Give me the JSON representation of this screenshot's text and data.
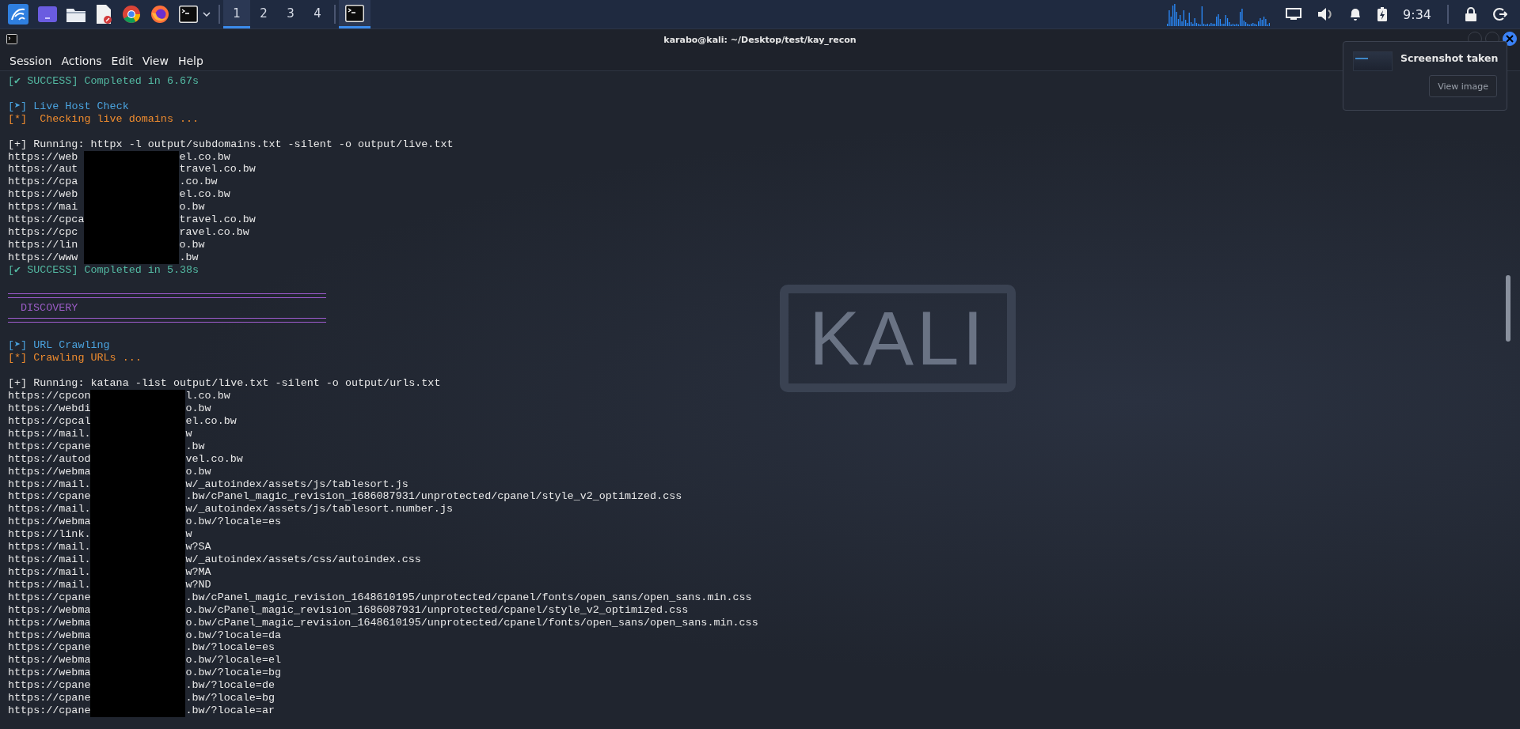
{
  "taskbar": {
    "launchers": [
      {
        "kind": "dragon"
      },
      {
        "kind": "desktop"
      },
      {
        "kind": "folder"
      },
      {
        "kind": "editor"
      },
      {
        "kind": "chrome"
      },
      {
        "kind": "fox"
      },
      {
        "kind": "terminal"
      }
    ],
    "workspaces": [
      {
        "label": "1",
        "selected": true
      },
      {
        "label": "2",
        "selected": false
      },
      {
        "label": "3",
        "selected": false
      },
      {
        "label": "4",
        "selected": false
      }
    ],
    "tasks": [
      {
        "kind": "terminal",
        "selected": true
      }
    ],
    "clock": "9:34"
  },
  "window": {
    "title": "karabo@kali: ~/Desktop/test/kay_recon",
    "menu": [
      "Session",
      "Actions",
      "Edit",
      "View",
      "Help"
    ],
    "lines": [
      {
        "kind": "success",
        "text": "[✔ SUCCESS] Completed in 6.67s"
      },
      {
        "kind": "blank"
      },
      {
        "kind": "step",
        "text": "[➤] Live Host Check"
      },
      {
        "kind": "info",
        "text": "[*]  Checking live domains ..."
      },
      {
        "kind": "blank"
      },
      {
        "kind": "plain",
        "text": "[+] Running: httpx -l output/subdomains.txt -silent -o output/live.txt"
      },
      {
        "kind": "redacted",
        "rows": [
          {
            "start": "https://web",
            "end": "el.co.bw"
          },
          {
            "start": "https://aut",
            "end": "travel.co.bw"
          },
          {
            "start": "https://cpa",
            "end": ".co.bw"
          },
          {
            "start": "https://web",
            "end": "el.co.bw"
          },
          {
            "start": "https://mai",
            "end": "o.bw"
          },
          {
            "start": "https://cpca",
            "end": "travel.co.bw"
          },
          {
            "start": "https://cpc",
            "end": "ravel.co.bw"
          },
          {
            "start": "https://lin",
            "end": "o.bw"
          },
          {
            "start": "https://www",
            "end": ".bw"
          }
        ]
      },
      {
        "kind": "success",
        "text": "[✔ SUCCESS] Completed in 5.38s"
      },
      {
        "kind": "blank"
      },
      {
        "kind": "rule"
      },
      {
        "kind": "banner",
        "text": "DISCOVERY"
      },
      {
        "kind": "rule"
      },
      {
        "kind": "blank"
      },
      {
        "kind": "step",
        "text": "[➤] URL Crawling"
      },
      {
        "kind": "info",
        "text": "[*] Crawling URLs ..."
      },
      {
        "kind": "blank"
      },
      {
        "kind": "plain",
        "text": "[+] Running: katana -list output/live.txt -silent -o output/urls.txt"
      },
      {
        "kind": "redacted",
        "rows": [
          {
            "start": "https://cpcon",
            "end": "l.co.bw"
          },
          {
            "start": "https://webdi",
            "end": "o.bw"
          },
          {
            "start": "https://cpcal",
            "end": "el.co.bw"
          },
          {
            "start": "https://mail.",
            "end": "w"
          },
          {
            "start": "https://cpane",
            "end": ".bw"
          },
          {
            "start": "https://autod",
            "end": "vel.co.bw"
          },
          {
            "start": "https://webma",
            "end": "o.bw"
          },
          {
            "start": "https://mail.",
            "end": "w/_autoindex/assets/js/tablesort.js"
          },
          {
            "start": "https://cpane",
            "end": ".bw/cPanel_magic_revision_1686087931/unprotected/cpanel/style_v2_optimized.css"
          },
          {
            "start": "https://mail.",
            "end": "w/_autoindex/assets/js/tablesort.number.js"
          },
          {
            "start": "https://webma",
            "end": "o.bw/?locale=es"
          },
          {
            "start": "https://link.",
            "end": "w"
          },
          {
            "start": "https://mail.",
            "end": "w?SA"
          },
          {
            "start": "https://mail.",
            "end": "w/_autoindex/assets/css/autoindex.css"
          },
          {
            "start": "https://mail.",
            "end": "w?MA"
          },
          {
            "start": "https://mail.",
            "end": "w?ND"
          },
          {
            "start": "https://cpane",
            "end": ".bw/cPanel_magic_revision_1648610195/unprotected/cpanel/fonts/open_sans/open_sans.min.css"
          },
          {
            "start": "https://webma",
            "end": "o.bw/cPanel_magic_revision_1686087931/unprotected/cpanel/style_v2_optimized.css"
          },
          {
            "start": "https://webma",
            "end": "o.bw/cPanel_magic_revision_1648610195/unprotected/cpanel/fonts/open_sans/open_sans.min.css"
          },
          {
            "start": "https://webma",
            "end": "o.bw/?locale=da"
          },
          {
            "start": "https://cpane",
            "end": ".bw/?locale=es"
          },
          {
            "start": "https://webma",
            "end": "o.bw/?locale=el"
          },
          {
            "start": "https://webma",
            "end": "o.bw/?locale=bg"
          },
          {
            "start": "https://cpane",
            "end": ".bw/?locale=de"
          },
          {
            "start": "https://cpane",
            "end": ".bw/?locale=bg"
          },
          {
            "start": "https://cpane",
            "end": ".bw/?locale=ar"
          }
        ]
      }
    ]
  },
  "wallpaper": {
    "logo": "KALI"
  },
  "notification": {
    "title": "Screenshot taken",
    "button": "View image"
  }
}
